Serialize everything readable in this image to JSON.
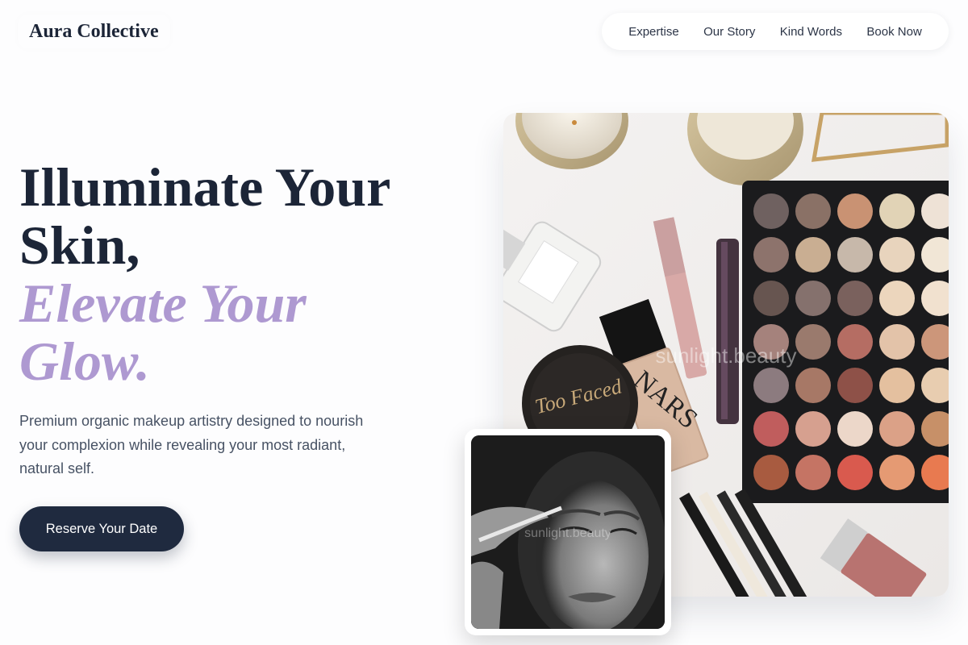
{
  "brand": {
    "name": "Aura Collective"
  },
  "nav": {
    "items": [
      "Expertise",
      "Our Story",
      "Kind Words",
      "Book Now"
    ]
  },
  "hero": {
    "headline_line1": "Illuminate Your",
    "headline_line2": "Skin,",
    "accent_line1": "Elevate Your",
    "accent_line2": "Glow.",
    "subtext": "Premium organic makeup artistry designed to nourish your complexion while revealing your most radiant, natural self.",
    "cta_label": "Reserve Your Date"
  },
  "images": {
    "main_watermark": "sunlight.beauty",
    "inset_watermark": "sunlight.beauty",
    "compact_brand": "Too Faced",
    "foundation_brand": "NARS"
  },
  "colors": {
    "accent": "#ae99d1",
    "navy": "#1f2a3f",
    "text": "#1c2537"
  }
}
